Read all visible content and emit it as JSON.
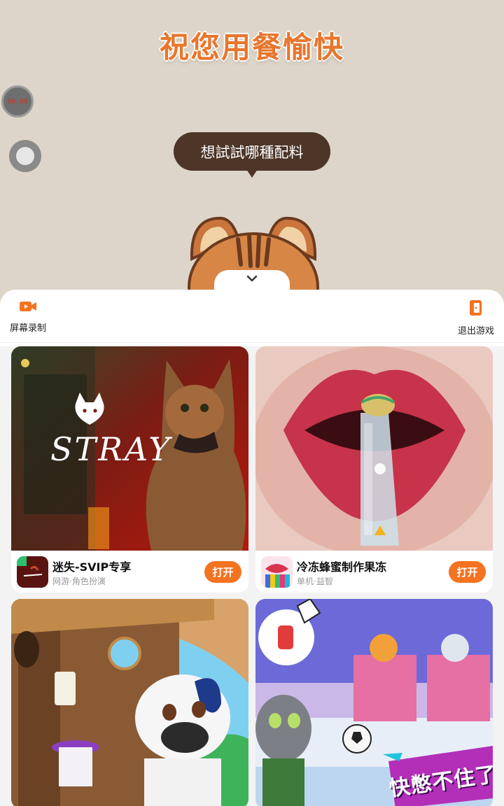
{
  "game": {
    "title": "祝您用餐愉快",
    "timer": "00:00",
    "speech_bubble": "想試試哪種配料"
  },
  "toolbar": {
    "screen_record_label": "屏幕录制",
    "exit_game_label": "退出游戏",
    "accent_color": "#f47321"
  },
  "cards": [
    {
      "name": "迷失-SVIP专享",
      "meta": "网游·角色扮演",
      "button": "打开",
      "banner_text": "STRAY"
    },
    {
      "name": "冷冻蜂蜜制作果冻",
      "meta": "单机·益智",
      "button": "打开"
    },
    {
      "name": "",
      "meta": "",
      "button": ""
    },
    {
      "name": "",
      "meta": "",
      "button": "",
      "banner_text": "快憋不住了"
    }
  ]
}
